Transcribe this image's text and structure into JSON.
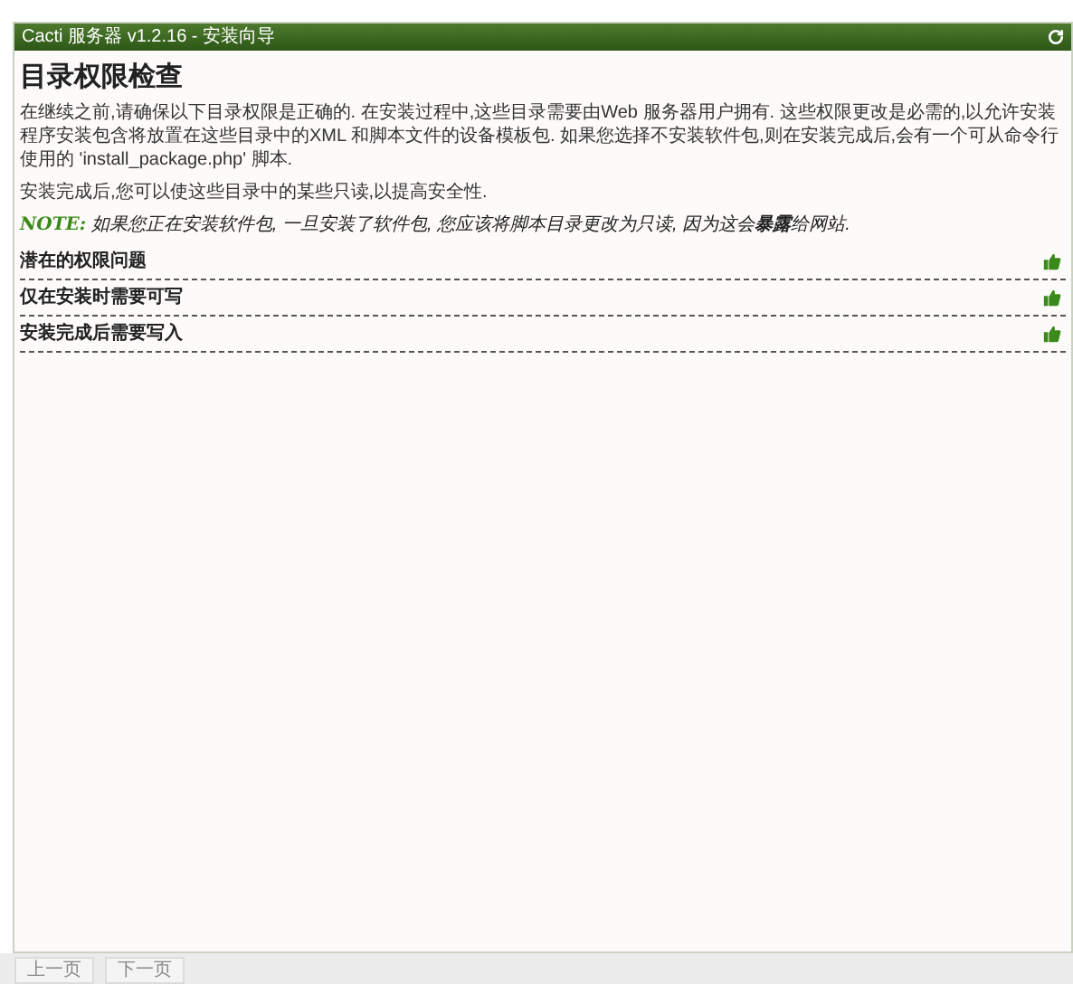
{
  "header": {
    "title": "Cacti 服务器 v1.2.16 - 安装向导"
  },
  "heading": "目录权限检查",
  "paragraphs": [
    "在继续之前,请确保以下目录权限是正确的. 在安装过程中,这些目录需要由Web 服务器用户拥有. 这些权限更改是必需的,以允许安装程序安装包含将放置在这些目录中的XML 和脚本文件的设备模板包. 如果您选择不安装软件包,则在安装完成后,会有一个可从命令行使用的 'install_package.php' 脚本.",
    "安装完成后,您可以使这些目录中的某些只读,以提高安全性."
  ],
  "note": {
    "label": "NOTE:",
    "text": "如果您正在安装软件包, 一旦安装了软件包, 您应该将脚本目录更改为只读, 因为这会**暴露**给网站."
  },
  "checks": [
    {
      "label": "潜在的权限问题",
      "passed": true
    },
    {
      "label": "仅在安装时需要可写",
      "passed": true
    },
    {
      "label": "安装完成后需要写入",
      "passed": true
    }
  ],
  "buttons": [
    "上一页",
    "下一页"
  ]
}
